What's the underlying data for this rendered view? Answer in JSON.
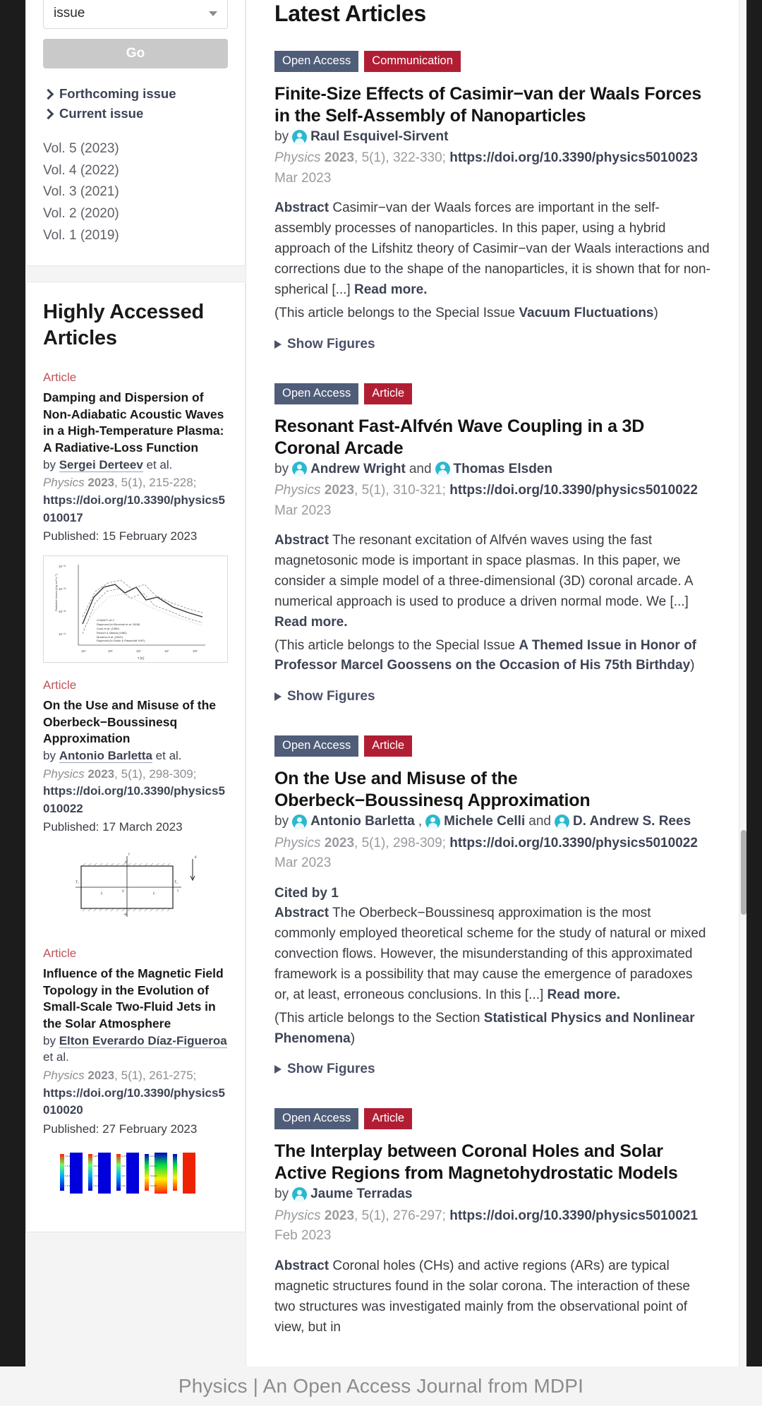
{
  "sidebar": {
    "issue_select": {
      "value": "issue",
      "caret_icon": "chevron-down-icon"
    },
    "go_button": "Go",
    "issue_links": [
      {
        "label": "Forthcoming issue",
        "icon": "chevron-right-icon"
      },
      {
        "label": "Current issue",
        "icon": "chevron-right-icon"
      }
    ],
    "volumes": [
      "Vol. 5 (2023)",
      "Vol. 4 (2022)",
      "Vol. 3 (2021)",
      "Vol. 2 (2020)",
      "Vol. 1 (2019)"
    ],
    "highly_accessed": {
      "heading": "Highly Accessed Articles",
      "articles": [
        {
          "kind": "Article",
          "title": "Damping and Dispersion of Non-Adiabatic Acoustic Waves in a High-Temperature Plasma: A Radiative-Loss Function",
          "by_prefix": "by",
          "author": "Sergei Derteev",
          "by_suffix": "et al.",
          "journal": "Physics",
          "year": "2023",
          "volissue": "5(1), 215-228;",
          "doi": "https://doi.org/10.3390/physics5010017",
          "published": "Published: 15 February 2023",
          "figure_alt": "radiative-loss-function-plot"
        },
        {
          "kind": "Article",
          "title": "On the Use and Misuse of the Oberbeck−Boussinesq Approximation",
          "by_prefix": "by",
          "author": "Antonio Barletta",
          "by_suffix": "et al.",
          "journal": "Physics",
          "year": "2023",
          "volissue": "5(1), 298-309;",
          "doi": "https://doi.org/10.3390/physics5010022",
          "published": "Published: 17 March 2023",
          "figure_alt": "boussinesq-cavity-diagram"
        },
        {
          "kind": "Article",
          "title": "Influence of the Magnetic Field Topology in the Evolution of Small-Scale Two-Fluid Jets in the Solar Atmosphere",
          "by_prefix": "by",
          "author": "Elton Everardo Díaz-Figueroa",
          "by_suffix": "et al.",
          "journal": "Physics",
          "year": "2023",
          "volissue": "5(1), 261-275;",
          "doi": "https://doi.org/10.3390/physics5010020",
          "published": "Published: 27 February 2023",
          "figure_alt": "solar-jets-colormap-panels"
        }
      ]
    }
  },
  "main": {
    "heading": "Latest Articles",
    "articles": [
      {
        "badge_access": "Open Access",
        "badge_type": "Communication",
        "title": "Finite-Size Effects of Casimir−van der Waals Forces in the Self-Assembly of Nanoparticles",
        "by_prefix": "by",
        "authors": [
          {
            "name": "Raul Esquivel-Sirvent",
            "icon": "author-avatar-icon"
          }
        ],
        "journal": "Physics",
        "year": "2023",
        "volissue": "5(1), 322-330;",
        "doi": "https://doi.org/10.3390/physics5010023",
        "date": "Mar 2023",
        "cited_by": "",
        "abstract_label": "Abstract",
        "abstract": "Casimir−van der Waals forces are important in the self-assembly processes of nanoparticles. In this paper, using a hybrid approach of the Lifshitz theory of Casimir−van der Waals interactions and corrections due to the shape of the nanoparticles, it is shown that for non-spherical [...]",
        "read_more": "Read more.",
        "belongs_prefix": "(This article belongs to the Special Issue ",
        "special_issue": "Vacuum Fluctuations",
        "belongs_suffix": ")",
        "show_figures": "Show Figures",
        "show_figures_icon": "triangle-right-icon"
      },
      {
        "badge_access": "Open Access",
        "badge_type": "Article",
        "title": "Resonant Fast-Alfvén Wave Coupling in a 3D Coronal Arcade",
        "by_prefix": "by",
        "authors": [
          {
            "name": "Andrew Wright",
            "icon": "author-avatar-icon"
          },
          {
            "name": "Thomas Elsden",
            "icon": "author-avatar-icon",
            "conjunction": "and"
          }
        ],
        "journal": "Physics",
        "year": "2023",
        "volissue": "5(1), 310-321;",
        "doi": "https://doi.org/10.3390/physics5010022",
        "date": "Mar 2023",
        "cited_by": "",
        "abstract_label": "Abstract",
        "abstract": "The resonant excitation of Alfvén waves using the fast magnetosonic mode is important in space plasmas. In this paper, we consider a simple model of a three-dimensional (3D) coronal arcade. A numerical approach is used to produce a driven normal mode. We [...]",
        "read_more": "Read more.",
        "belongs_prefix": "(This article belongs to the Special Issue ",
        "special_issue": "A Themed Issue in Honor of Professor Marcel Goossens on the Occasion of His 75th Birthday",
        "belongs_suffix": ")",
        "show_figures": "Show Figures",
        "show_figures_icon": "triangle-right-icon"
      },
      {
        "badge_access": "Open Access",
        "badge_type": "Article",
        "title": "On the Use and Misuse of the Oberbeck−Boussinesq Approximation",
        "by_prefix": "by",
        "authors": [
          {
            "name": "Antonio Barletta",
            "icon": "author-avatar-icon"
          },
          {
            "name": "Michele Celli",
            "icon": "author-avatar-icon"
          },
          {
            "name": "D. Andrew S. Rees",
            "icon": "author-avatar-icon",
            "conjunction": "and"
          }
        ],
        "journal": "Physics",
        "year": "2023",
        "volissue": "5(1), 298-309;",
        "doi": "https://doi.org/10.3390/physics5010022",
        "date": "Mar 2023",
        "cited_by": "Cited by 1",
        "abstract_label": "Abstract",
        "abstract": "The Oberbeck−Boussinesq approximation is the most commonly employed theoretical scheme for the study of natural or mixed convection flows. However, the misunderstanding of this approximated framework is a possibility that may cause the emergence of paradoxes or, at least, erroneous conclusions. In this [...]",
        "read_more": "Read more.",
        "belongs_prefix": "(This article belongs to the Section ",
        "special_issue": "Statistical Physics and Nonlinear Phenomena",
        "belongs_suffix": ")",
        "show_figures": "Show Figures",
        "show_figures_icon": "triangle-right-icon"
      },
      {
        "badge_access": "Open Access",
        "badge_type": "Article",
        "title": "The Interplay between Coronal Holes and Solar Active Regions from Magnetohydrostatic Models",
        "by_prefix": "by",
        "authors": [
          {
            "name": "Jaume Terradas",
            "icon": "author-avatar-icon"
          }
        ],
        "journal": "Physics",
        "year": "2023",
        "volissue": "5(1), 276-297;",
        "doi": "https://doi.org/10.3390/physics5010021",
        "date": "Feb 2023",
        "cited_by": "",
        "abstract_label": "Abstract",
        "abstract": "Coronal holes (CHs) and active regions (ARs) are typical magnetic structures found in the solar corona. The interaction of these two structures was investigated mainly from the observational point of view, but in",
        "read_more": "",
        "belongs_prefix": "",
        "special_issue": "",
        "belongs_suffix": "",
        "show_figures": "",
        "show_figures_icon": ""
      }
    ]
  },
  "footer": {
    "text": "Physics | An Open Access Journal from MDPI"
  },
  "colors": {
    "open_access_badge": "#4f5d79",
    "article_badge": "#b11e34",
    "link": "#3d4354",
    "kind_label": "#c0535a",
    "avatar": "#2bb8cf"
  }
}
